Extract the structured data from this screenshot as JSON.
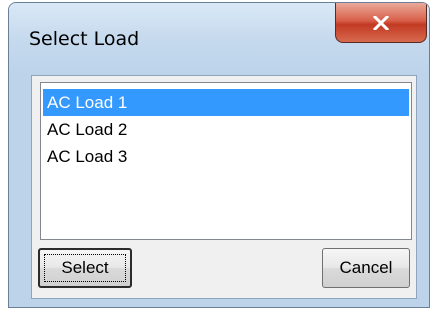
{
  "window": {
    "title": "Select Load"
  },
  "list": {
    "items": [
      {
        "label": "AC Load 1",
        "selected": true
      },
      {
        "label": "AC Load 2",
        "selected": false
      },
      {
        "label": "AC Load 3",
        "selected": false
      }
    ]
  },
  "buttons": {
    "select_label": "Select",
    "cancel_label": "Cancel"
  },
  "icons": {
    "close": "close-icon"
  },
  "colors": {
    "selection": "#3399ff",
    "close_button": "#c23a22",
    "frame": "#bcd3ea"
  }
}
